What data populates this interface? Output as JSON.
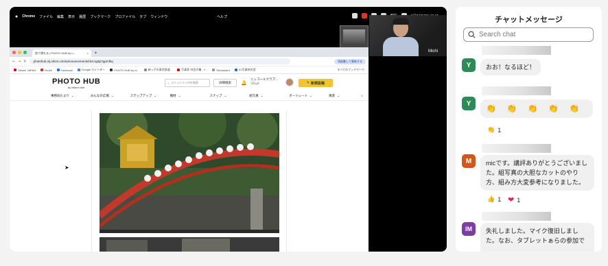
{
  "screen": {
    "menubar": {
      "app": "Chrome",
      "items": [
        "ファイル",
        "編集",
        "表示",
        "履歴",
        "ブックマーク",
        "プロファイル",
        "タブ",
        "ウィンドウ"
      ],
      "help": "ヘルプ",
      "battery": "86%",
      "datetime": "8月24日(日)  10:11"
    },
    "participant": {
      "name": "Michi"
    },
    "browser": {
      "tab_title": "皆で帰れる | PHOTO HUB by n...",
      "url": "photohub.nij.nikon.com/announcements/rkzcogkp7gpmfkq",
      "relaunch": "再起動して更新する",
      "bookmarks": [
        "Yahoo! JAPAN",
        "Gmail",
        "Facebook",
        "Google カレンダー",
        "PHOTO HUB by ni...",
        "新っ子の東京鉄道...",
        "写真家 村田大輔 - Y...",
        "Streamlard",
        "K2写真研究室"
      ],
      "all_bookmarks": "すべてのブックマーク"
    },
    "site": {
      "logo": "PHOTO HUB",
      "logo_sub": "by nikkor club",
      "search_placeholder": "コミュニティ内を検索",
      "advanced": "詳細検索",
      "club_name": "ニッコールクラブ...",
      "points": "32Lpt",
      "post": "新規投稿",
      "nav": [
        "事務局だより",
        "みんなの広場",
        "ステップアップ",
        "機材",
        "スナップ",
        "組写真",
        "ポートレート",
        "風景"
      ]
    }
  },
  "chat": {
    "title": "チャットメッセージ",
    "search_placeholder": "Search chat",
    "messages": [
      {
        "initials": "Y",
        "color": "#2e8b57",
        "text": "おお！なるほど！"
      },
      {
        "initials": "Y",
        "color": "#2e8b57",
        "emojis": "👏 👏 👏 👏 👏",
        "reactions": [
          {
            "emoji": "👏",
            "count": "1"
          }
        ]
      },
      {
        "initials": "M",
        "color": "#cc5a1e",
        "text": "micです。講評ありがとうございました。組写真の大胆なカットのやり方、組み方大変参考になりました。",
        "reactions": [
          {
            "emoji": "👍",
            "count": "1"
          },
          {
            "emoji": "❤",
            "count": "1"
          }
        ]
      },
      {
        "initials": "IM",
        "color": "#7a3fa0",
        "text": "失礼しました。マイク復旧しました。なお、タブレットぁらの参加で"
      }
    ]
  },
  "colors": {
    "accent_yellow": "#f4c430",
    "avatar_y": "#2e8b57",
    "avatar_m": "#cc5a1e",
    "avatar_im": "#7a3fa0"
  }
}
